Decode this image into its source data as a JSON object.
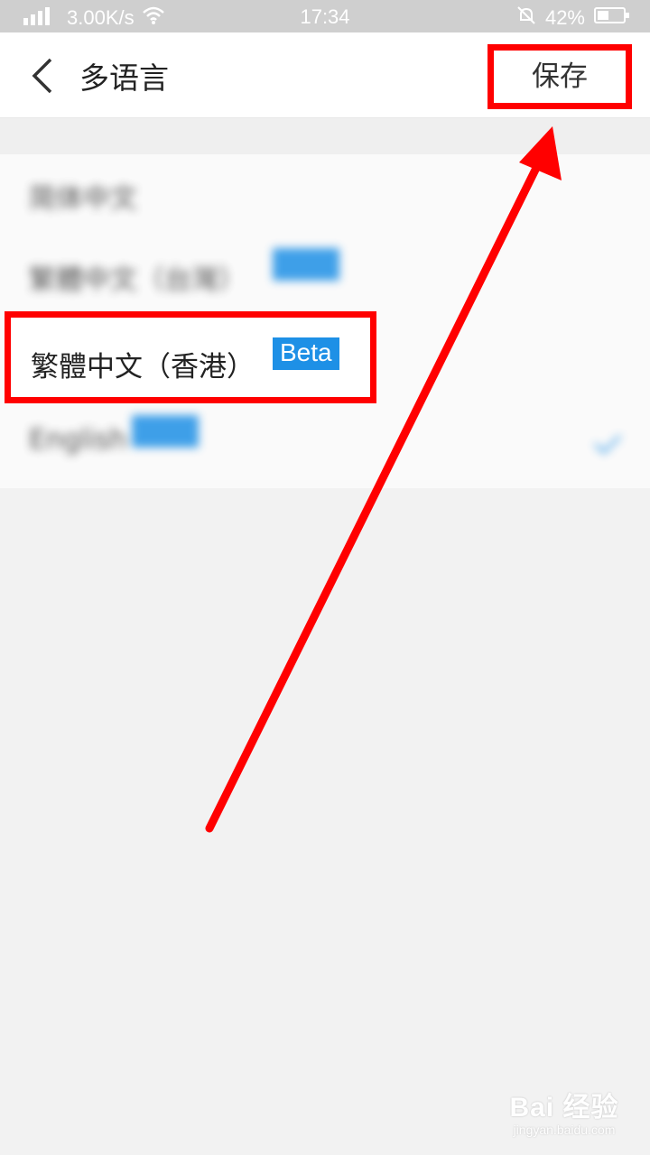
{
  "status_bar": {
    "speed": "3.00K/s",
    "time": "17:34",
    "battery": "42%"
  },
  "header": {
    "title": "多语言",
    "save_label": "保存"
  },
  "languages": [
    {
      "label": "简体中文",
      "badge": "",
      "blurred": true,
      "checked": false
    },
    {
      "label": "繁體中文（台灣）",
      "badge": "Beta",
      "blurred": true,
      "checked": false
    },
    {
      "label": "繁體中文（香港）",
      "badge": "Beta",
      "blurred": false,
      "checked": false,
      "highlighted": true
    },
    {
      "label": "English",
      "badge": "Beta",
      "blurred": true,
      "checked": true
    }
  ],
  "watermark": {
    "main": "Bai 经验",
    "sub": "jingyan.baidu.com"
  },
  "colors": {
    "annotation": "#ff0000",
    "badge": "#1e90e6"
  }
}
